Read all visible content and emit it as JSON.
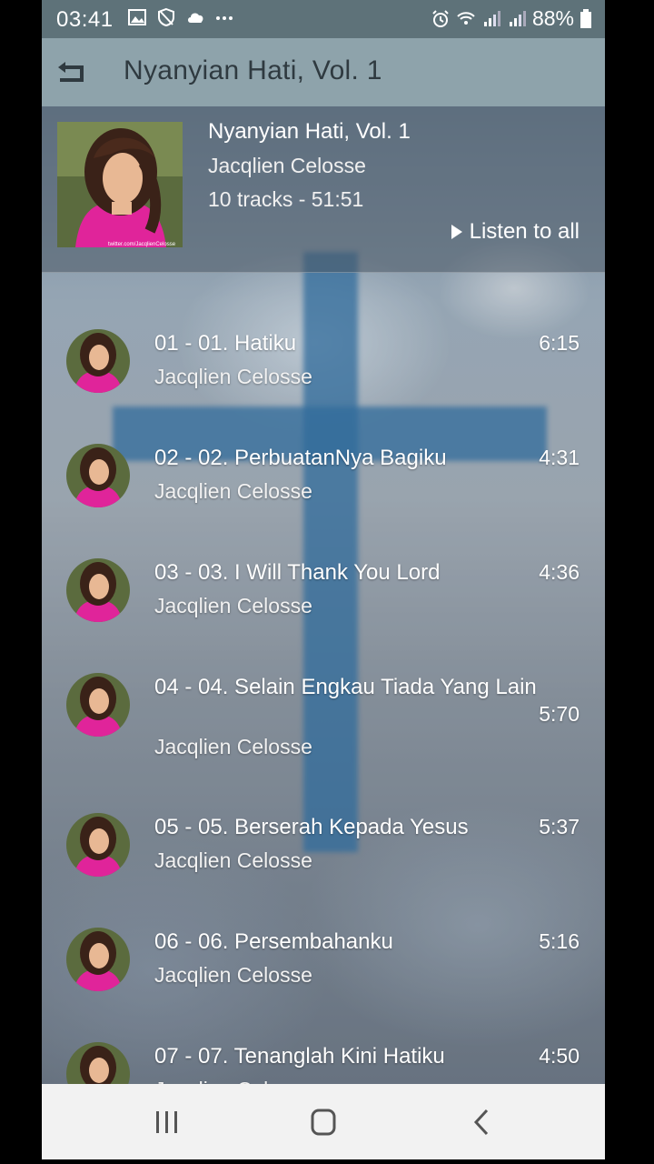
{
  "status_bar": {
    "time": "03:41",
    "battery": "88%",
    "left_icons": [
      "image-icon",
      "shield-icon",
      "cloud-icon",
      "more-dots-icon"
    ],
    "right_icons": [
      "alarm-icon",
      "wifi-icon",
      "signal-icon",
      "signal-icon",
      "battery-icon"
    ]
  },
  "app_bar": {
    "title": "Nyanyian Hati, Vol. 1",
    "back_icon": "back-arrow-icon"
  },
  "album": {
    "title": "Nyanyian Hati, Vol. 1",
    "artist": "Jacqlien Celosse",
    "meta": "10 tracks - 51:51",
    "listen_all": "Listen to all",
    "cover_watermark": "twitter.com/JacqlienCelosse"
  },
  "tracks": [
    {
      "title": "01 - 01. Hatiku",
      "artist": "Jacqlien Celosse",
      "duration": "6:15"
    },
    {
      "title": "02 - 02. PerbuatanNya Bagiku",
      "artist": "Jacqlien Celosse",
      "duration": "4:31"
    },
    {
      "title": "03 - 03. I Will Thank You Lord",
      "artist": "Jacqlien Celosse",
      "duration": "4:36"
    },
    {
      "title": "04 - 04. Selain Engkau Tiada Yang Lain",
      "artist": "Jacqlien Celosse",
      "duration": "5:70"
    },
    {
      "title": "05 - 05. Berserah Kepada Yesus",
      "artist": "Jacqlien Celosse",
      "duration": "5:37"
    },
    {
      "title": "06 - 06. Persembahanku",
      "artist": "Jacqlien Celosse",
      "duration": "5:16"
    },
    {
      "title": "07 - 07. Tenanglah Kini Hatiku",
      "artist": "Jacqlien Celosse",
      "duration": "4:50"
    }
  ],
  "nav_bar": {
    "icons": [
      "recent-apps-icon",
      "home-icon",
      "back-icon"
    ]
  },
  "colors": {
    "status_bar": "#5e7279",
    "app_bar": "#8ea3ab",
    "nav_bar": "#f2f2f2",
    "cross": "#286ea5"
  }
}
